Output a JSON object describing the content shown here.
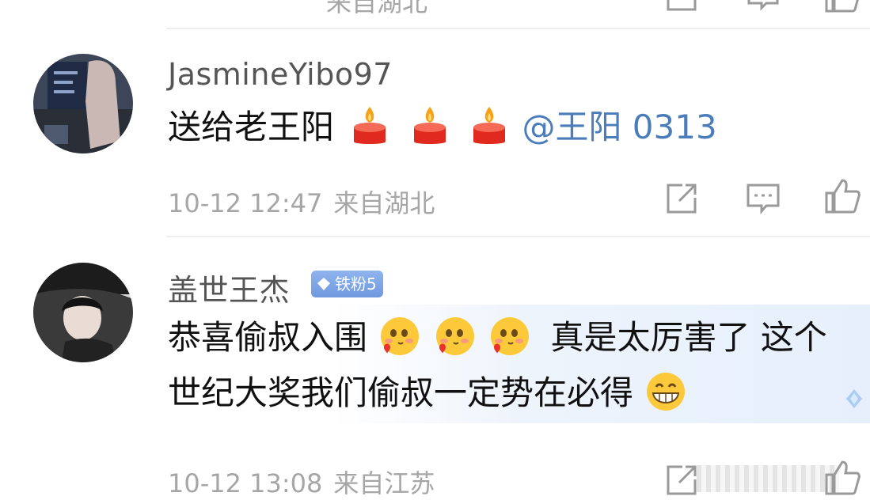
{
  "comments": [
    {
      "username": "JasmineYibo97",
      "text": "送给老王阳",
      "mention": "@王阳 0313",
      "time": "10-12 12:47",
      "location": "来自湖北"
    },
    {
      "username": "盖世王杰",
      "badge": "铁粉5",
      "line1_a": "恭喜偷叔入围",
      "line1_b": "真是太厉害了 这个",
      "line2": "世纪大奖我们偷叔一定势在必得",
      "time": "10-12 13:08",
      "location": "来自江苏"
    }
  ],
  "top_partial_location": "来自湖北",
  "colors": {
    "mention": "#4a7db9",
    "meta_gray": "#a6a6a6",
    "badge_blue": "#7aa2e6"
  },
  "icons": [
    "share-icon",
    "comment-icon",
    "like-icon",
    "candle-emoji",
    "blush-emoji",
    "grin-emoji",
    "diamond-icon"
  ]
}
